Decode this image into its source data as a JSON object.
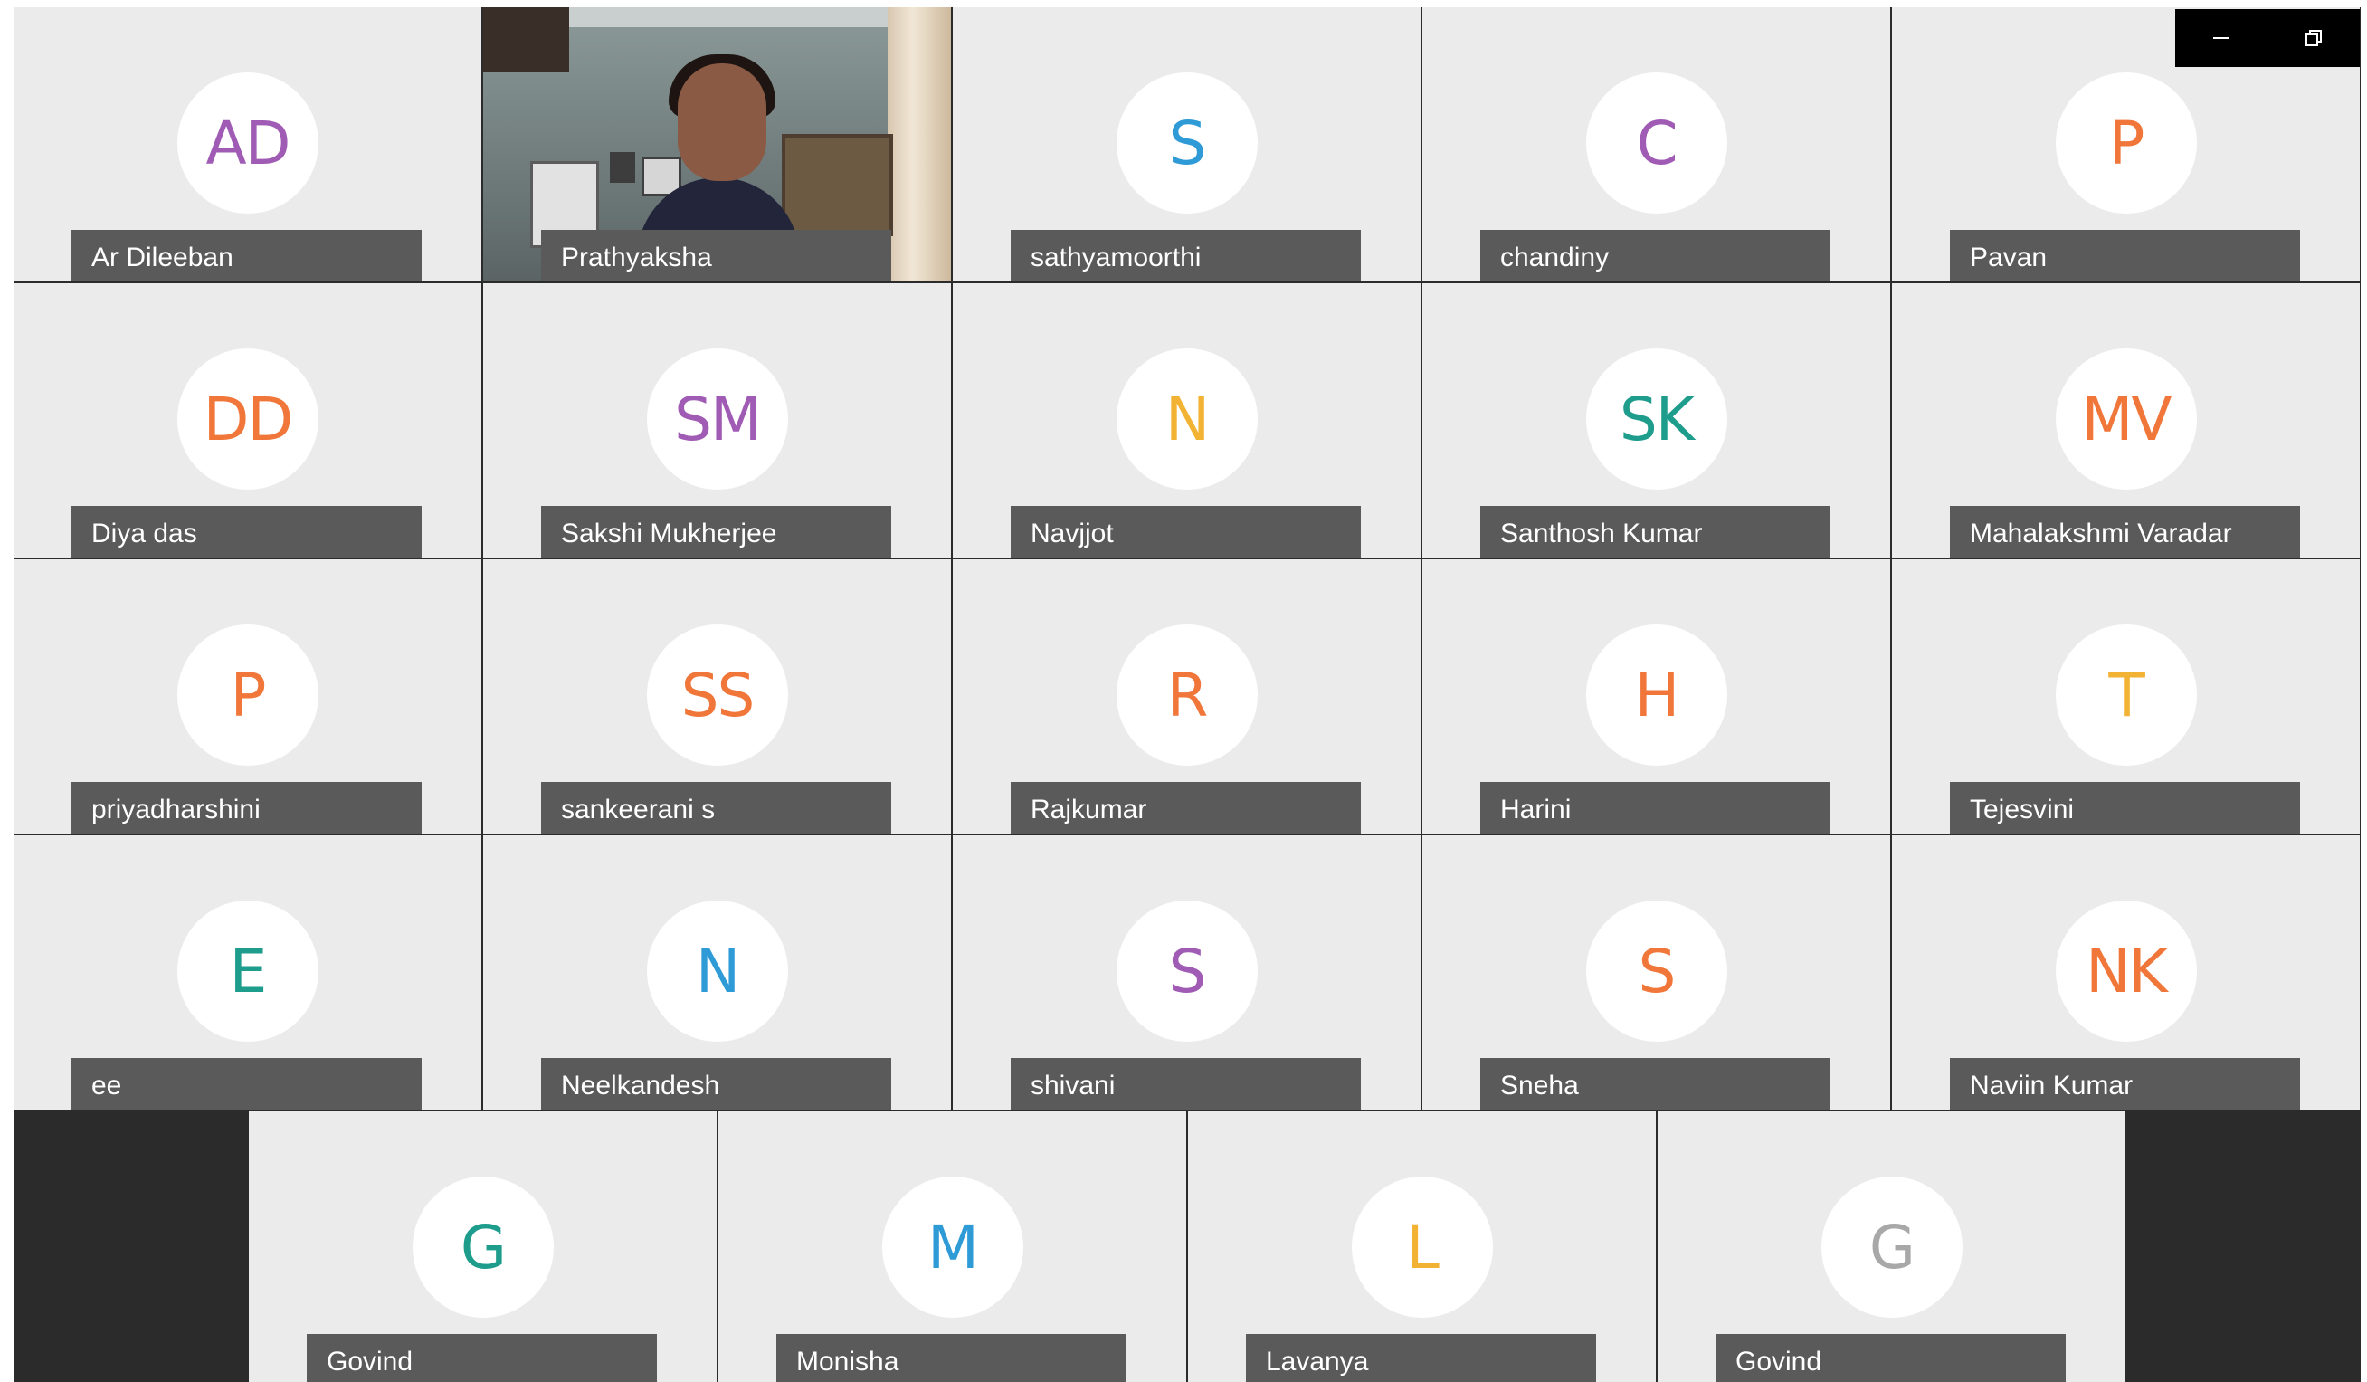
{
  "window_controls": {
    "minimize_icon": "minimize-icon",
    "restore_icon": "restore-icon"
  },
  "participants": [
    {
      "name": "Ar Dileeban",
      "initials": "AD",
      "color": "#a05cb4"
    },
    {
      "name": "Prathyaksha",
      "initials": "",
      "color": "",
      "video": true
    },
    {
      "name": "sathyamoorthi",
      "initials": "S",
      "color": "#2e9bd6"
    },
    {
      "name": "chandiny",
      "initials": "C",
      "color": "#a05cb4"
    },
    {
      "name": "Pavan",
      "initials": "P",
      "color": "#f0763a"
    },
    {
      "name": "Diya das",
      "initials": "DD",
      "color": "#f0763a"
    },
    {
      "name": "Sakshi Mukherjee",
      "initials": "SM",
      "color": "#a05cb4"
    },
    {
      "name": "Navjjot",
      "initials": "N",
      "color": "#f2b233"
    },
    {
      "name": "Santhosh Kumar",
      "initials": "SK",
      "color": "#1e9c8c"
    },
    {
      "name": "Mahalakshmi Varadar",
      "initials": "MV",
      "color": "#f0763a"
    },
    {
      "name": "priyadharshini",
      "initials": "P",
      "color": "#f0763a"
    },
    {
      "name": "sankeerani s",
      "initials": "SS",
      "color": "#f0763a"
    },
    {
      "name": "Rajkumar",
      "initials": "R",
      "color": "#f0763a"
    },
    {
      "name": "Harini",
      "initials": "H",
      "color": "#f0763a"
    },
    {
      "name": "Tejesvini",
      "initials": "T",
      "color": "#f2b233"
    },
    {
      "name": "ee",
      "initials": "E",
      "color": "#1e9c8c"
    },
    {
      "name": "Neelkandesh",
      "initials": "N",
      "color": "#2e9bd6"
    },
    {
      "name": "shivani",
      "initials": "S",
      "color": "#a05cb4"
    },
    {
      "name": "Sneha",
      "initials": "S",
      "color": "#f0763a"
    },
    {
      "name": "Naviin Kumar",
      "initials": "NK",
      "color": "#f0763a"
    }
  ],
  "bottom_participants": [
    {
      "name": "Govind",
      "initials": "G",
      "color": "#1e9c8c"
    },
    {
      "name": "Monisha",
      "initials": "M",
      "color": "#2e9bd6"
    },
    {
      "name": "Lavanya",
      "initials": "L",
      "color": "#f2b233"
    },
    {
      "name": "Govind",
      "initials": "G",
      "color": "#a8a8a8"
    }
  ]
}
